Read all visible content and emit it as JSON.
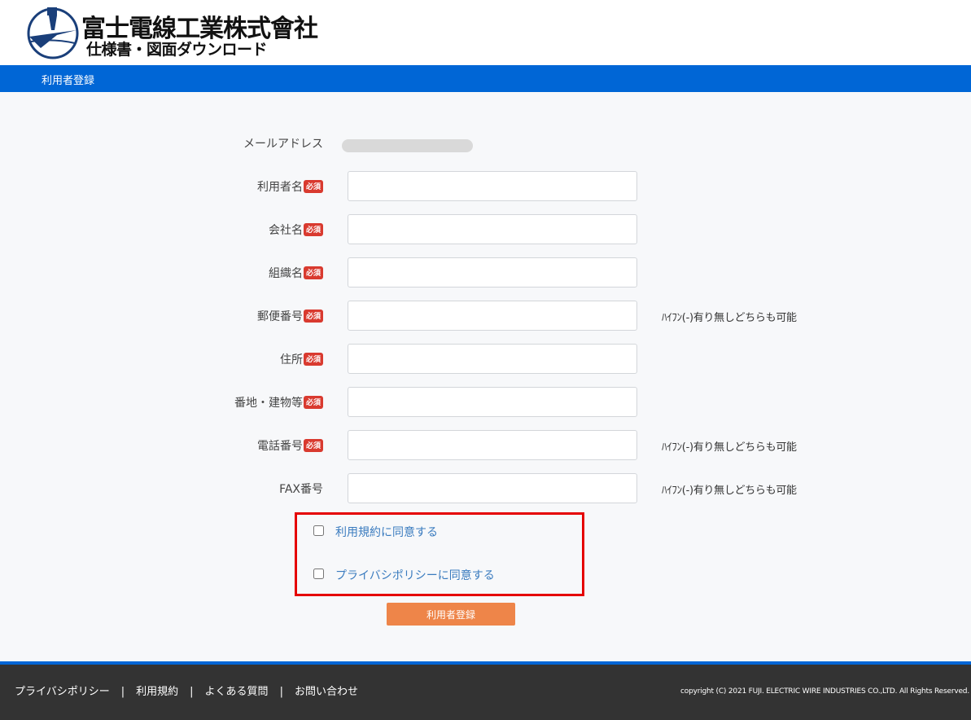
{
  "header": {
    "company_name": "富士電線工業株式會社",
    "subtitle": "仕様書・図面ダウンロード"
  },
  "nav": {
    "title": "利用者登録"
  },
  "form": {
    "required_badge": "必須",
    "email_label": "メールアドレス",
    "fields": [
      {
        "label": "利用者名",
        "required": true,
        "value": "",
        "hint": ""
      },
      {
        "label": "会社名",
        "required": true,
        "value": "",
        "hint": ""
      },
      {
        "label": "組織名",
        "required": true,
        "value": "",
        "hint": ""
      },
      {
        "label": "郵便番号",
        "required": true,
        "value": "",
        "hint": "ﾊｲﾌﾝ(-)有り無しどちらも可能"
      },
      {
        "label": "住所",
        "required": true,
        "value": "",
        "hint": ""
      },
      {
        "label": "番地・建物等",
        "required": true,
        "value": "",
        "hint": ""
      },
      {
        "label": "電話番号",
        "required": true,
        "value": "",
        "hint": "ﾊｲﾌﾝ(-)有り無しどちらも可能"
      },
      {
        "label": "FAX番号",
        "required": false,
        "value": "",
        "hint": "ﾊｲﾌﾝ(-)有り無しどちらも可能"
      }
    ],
    "consents": [
      {
        "label": "利用規約に同意する",
        "checked": false
      },
      {
        "label": "プライバシポリシーに同意する",
        "checked": false
      }
    ],
    "submit_label": "利用者登録"
  },
  "footer": {
    "links": [
      "プライバシポリシー",
      "利用規約",
      "よくある質問",
      "お問い合わせ"
    ],
    "separator": "|",
    "copyright": "copyright (C) 2021 FUJI. ELECTRIC WIRE INDUSTRIES CO.,LTD. All Rights Reserved."
  },
  "colors": {
    "nav_blue": "#0066d6",
    "required_red": "#d93a2f",
    "submit_orange": "#ee8549",
    "highlight_red": "#e50000",
    "link_blue": "#3a7bbf",
    "footer_bg": "#333333"
  }
}
